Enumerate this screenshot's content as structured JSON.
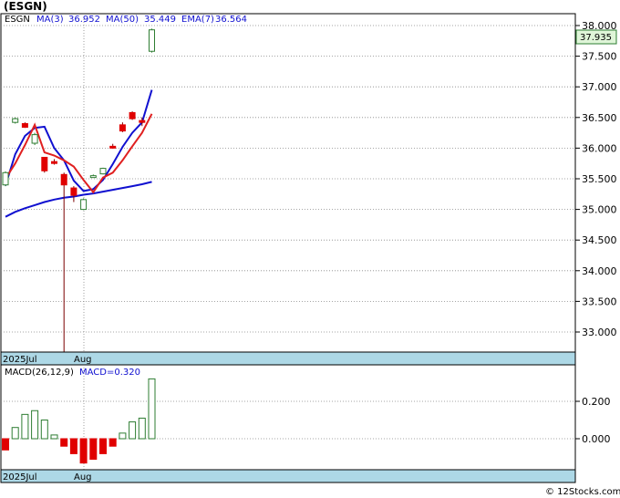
{
  "title": "(ESGN)",
  "legend": {
    "ticker": "ESGN",
    "ma3_label": "MA(3)",
    "ma3_value": "36.952",
    "ma50_label": "MA(50)",
    "ma50_value": "35.449",
    "ema7_label": "EMA(7)",
    "ema7_value": "36.564"
  },
  "last_price": "37.935",
  "price_ticks": [
    "38.000",
    "37.500",
    "37.000",
    "36.500",
    "36.000",
    "35.500",
    "35.000",
    "34.500",
    "34.000",
    "33.500",
    "33.000"
  ],
  "macd_ticks": [
    "0.200",
    "0.000"
  ],
  "x_labels": {
    "a": "2025Jul",
    "b": "Aug"
  },
  "macd_legend": {
    "label": "MACD(26,12,9)",
    "value_label": "MACD=0.320"
  },
  "footer": "© 12Stocks.com",
  "colors": {
    "up": "#2e7d32",
    "down": "#e00000",
    "ma": "#1010d0",
    "ema": "#e02020",
    "axisbar": "#add8e6"
  },
  "chart_data": [
    {
      "type": "candlestick",
      "ylim": [
        32.6,
        38.2
      ],
      "candles": [
        {
          "o": 35.4,
          "h": 35.62,
          "l": 35.38,
          "c": 35.6
        },
        {
          "o": 36.42,
          "h": 36.5,
          "l": 36.4,
          "c": 36.48
        },
        {
          "o": 36.4,
          "h": 36.42,
          "l": 36.33,
          "c": 36.34
        },
        {
          "o": 36.08,
          "h": 36.25,
          "l": 36.05,
          "c": 36.22
        },
        {
          "o": 35.85,
          "h": 35.85,
          "l": 35.6,
          "c": 35.63
        },
        {
          "o": 35.78,
          "h": 35.82,
          "l": 35.73,
          "c": 35.76
        },
        {
          "o": 35.57,
          "h": 35.6,
          "l": 32.6,
          "c": 35.4
        },
        {
          "o": 35.35,
          "h": 35.38,
          "l": 35.12,
          "c": 35.23
        },
        {
          "o": 35.0,
          "h": 35.18,
          "l": 34.99,
          "c": 35.16
        },
        {
          "o": 35.53,
          "h": 35.57,
          "l": 35.52,
          "c": 35.55
        },
        {
          "o": 35.58,
          "h": 35.68,
          "l": 35.57,
          "c": 35.67
        },
        {
          "o": 36.03,
          "h": 36.07,
          "l": 35.99,
          "c": 36.01
        },
        {
          "o": 36.38,
          "h": 36.42,
          "l": 36.26,
          "c": 36.28
        },
        {
          "o": 36.58,
          "h": 36.6,
          "l": 36.46,
          "c": 36.48
        },
        {
          "o": 36.45,
          "h": 36.5,
          "l": 36.36,
          "c": 36.42
        },
        {
          "o": 37.58,
          "h": 37.95,
          "l": 37.56,
          "c": 37.93
        }
      ],
      "series": [
        {
          "name": "MA(3)",
          "values": [
            35.39,
            35.9,
            36.2,
            36.33,
            36.35,
            36.0,
            35.8,
            35.47,
            35.3,
            35.33,
            35.48,
            35.74,
            36.02,
            36.25,
            36.42,
            36.95
          ]
        },
        {
          "name": "MA(50)",
          "values": [
            34.88,
            34.96,
            35.02,
            35.07,
            35.12,
            35.16,
            35.19,
            35.21,
            35.24,
            35.26,
            35.29,
            35.32,
            35.35,
            35.38,
            35.41,
            35.45
          ]
        },
        {
          "name": "EMA(7)",
          "values": [
            35.5,
            35.75,
            36.05,
            36.38,
            35.93,
            35.88,
            35.8,
            35.7,
            35.48,
            35.28,
            35.52,
            35.6,
            35.8,
            36.03,
            36.25,
            36.56
          ]
        }
      ]
    },
    {
      "type": "bar",
      "series": [
        {
          "name": "MACD(26,12,9)",
          "values": [
            -0.06,
            0.06,
            0.13,
            0.15,
            0.1,
            0.02,
            -0.04,
            -0.08,
            -0.13,
            -0.11,
            -0.08,
            -0.04,
            0.03,
            0.09,
            0.11,
            0.32
          ]
        }
      ]
    }
  ]
}
